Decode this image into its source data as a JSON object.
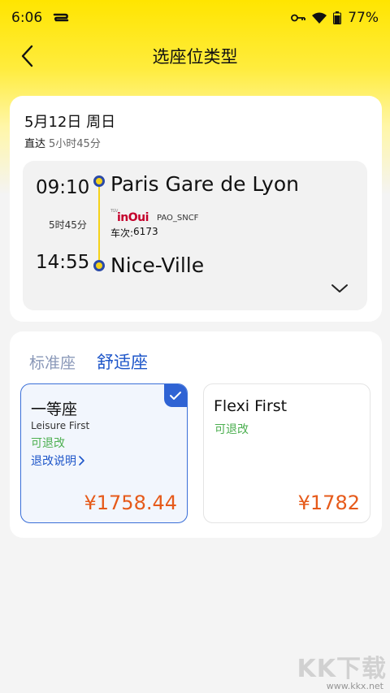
{
  "status_bar": {
    "time": "6:06",
    "battery": "77%"
  },
  "header": {
    "title": "选座位类型"
  },
  "journey": {
    "date": "5月12日 周日",
    "type": "直达",
    "total_duration": "5小时45分",
    "departure_time": "09:10",
    "departure_station": "Paris Gare de Lyon",
    "segment_duration": "5时45分",
    "brand_small": "TGV",
    "brand": "inOui",
    "operator": "PAO_SNCF",
    "train_label": "车次:",
    "train_number": "6173",
    "arrival_time": "14:55",
    "arrival_station": "Nice-Ville"
  },
  "tabs": [
    {
      "label": "标准座",
      "active": false
    },
    {
      "label": "舒适座",
      "active": true
    }
  ],
  "options": [
    {
      "name": "一等座",
      "subtitle": "Leisure First",
      "refund": "可退改",
      "rules_label": "退改说明",
      "price": "¥1758.44",
      "selected": true
    },
    {
      "name": "Flexi First",
      "refund": "可退改",
      "price": "¥1782",
      "selected": false
    }
  ],
  "watermark": {
    "big": "KK下载",
    "small": "www.kkx.net"
  },
  "colors": {
    "accent": "#1e56c9",
    "price": "#e65a1a",
    "refund": "#4caf50",
    "header_yellow": "#ffe500"
  }
}
